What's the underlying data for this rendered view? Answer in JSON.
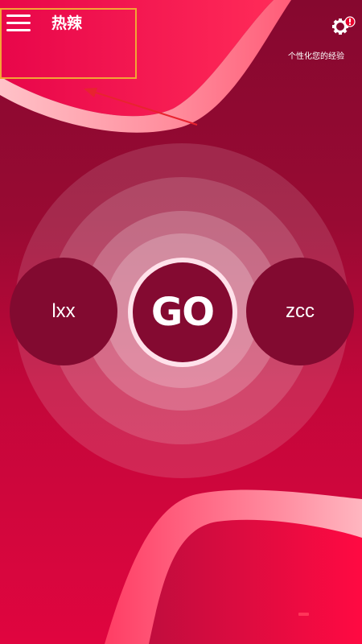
{
  "header": {
    "title": "热辣",
    "menu_icon": "hamburger-menu-icon",
    "settings_icon": "gear-with-alert-icon",
    "tagline": "个性化您的经验"
  },
  "main": {
    "left_player": "lxx",
    "go_label": "GO",
    "right_player": "zcc"
  },
  "colors": {
    "background_dark": "#86082f",
    "background_light": "#e0053f",
    "circle_fill": "#820a30",
    "annotation_box": "#f2a535",
    "annotation_arrow": "#e8232f",
    "alert_badge": "#e8002d"
  }
}
